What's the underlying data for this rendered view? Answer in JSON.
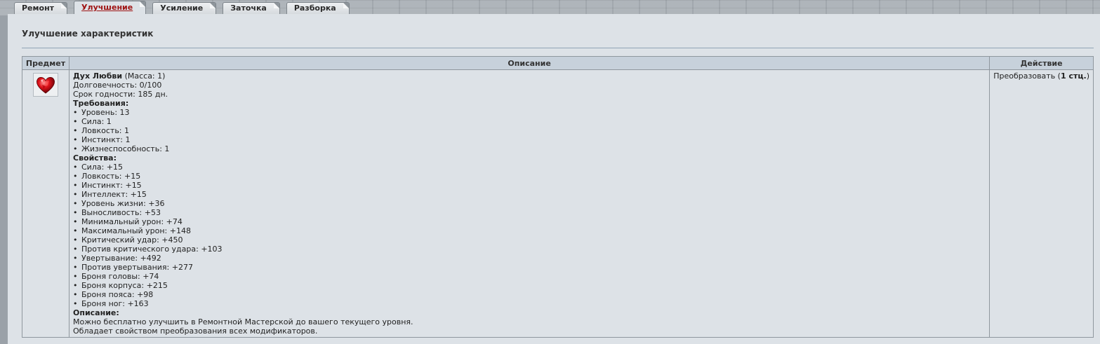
{
  "tabs": [
    {
      "label": "Ремонт",
      "active": false
    },
    {
      "label": "Улучшение",
      "active": true
    },
    {
      "label": "Усиление",
      "active": false
    },
    {
      "label": "Заточка",
      "active": false
    },
    {
      "label": "Разборка",
      "active": false
    }
  ],
  "page_title": "Улучшение характеристик",
  "table": {
    "headers": {
      "item": "Предмет",
      "description": "Описание",
      "action": "Действие"
    },
    "row": {
      "item_icon": "heart-gem-icon",
      "name": "Дух Любви",
      "mass": " (Масса: 1)",
      "durability": "Долговечность: 0/100",
      "expiry": "Срок годности: 185 дн.",
      "requirements_title": "Требования:",
      "requirements": [
        "Уровень: 13",
        "Сила: 1",
        "Ловкость: 1",
        "Инстинкт: 1",
        "Жизнеспособность: 1"
      ],
      "properties_title": "Свойства:",
      "properties": [
        "Сила: +15",
        "Ловкость: +15",
        "Инстинкт: +15",
        "Интеллект: +15",
        "Уровень жизни: +36",
        "Выносливость: +53",
        "Минимальный урон: +74",
        "Максимальный урон: +148",
        "Критический удар: +450",
        "Против критического удара: +103",
        "Увертывание: +492",
        "Против увертывания: +277",
        "Броня головы: +74",
        "Броня корпуса: +215",
        "Броня пояса: +98",
        "Броня ног: +163"
      ],
      "description_title": "Описание:",
      "description_lines": [
        "Можно бесплатно улучшить в Ремонтной Мастерской до вашего текущего уровня.",
        "Обладает свойством преобразования всех модификаторов."
      ],
      "action_prefix": "Преобразовать (",
      "action_bold": "1 стц.",
      "action_suffix": ")"
    }
  },
  "colors": {
    "active_tab_text": "#9e1212",
    "header_bg": "#c7d1db",
    "panel_bg": "#dde2e7"
  }
}
